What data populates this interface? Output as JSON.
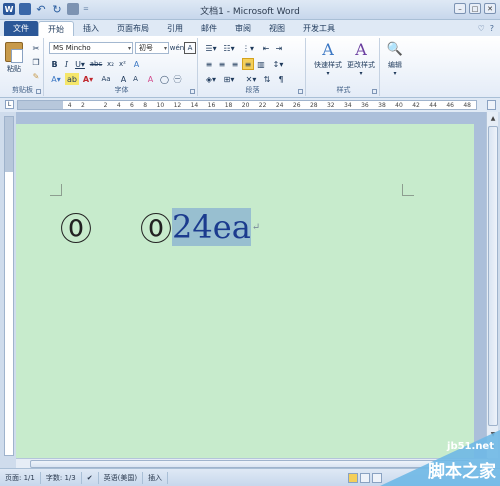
{
  "window": {
    "title": "文档1 - Microsoft Word",
    "buttons": [
      "–",
      "□",
      "✕"
    ]
  },
  "qat": {
    "word_icon": "W",
    "save_icon": "save-icon",
    "undo_icon": "↶",
    "redo_icon": "↻",
    "print_icon": "print-preview-icon",
    "dropdown": "="
  },
  "tabs": {
    "file": "文件",
    "items": [
      "开始",
      "插入",
      "页面布局",
      "引用",
      "邮件",
      "审阅",
      "视图",
      "开发工具"
    ],
    "right": [
      "♡",
      "?"
    ]
  },
  "ribbon": {
    "clipboard": {
      "paste": "粘贴",
      "label": "剪贴板"
    },
    "font": {
      "family": "MS Mincho",
      "size": "初号",
      "label": "字体",
      "grow": "A",
      "shrink": "A",
      "case": "Aa",
      "clear": "A",
      "wen": "wén",
      "char_border": "A"
    },
    "paragraph": {
      "label": "段落"
    },
    "styles": {
      "quick": "快速样式",
      "change": "更改样式",
      "label": "样式"
    },
    "editing": {
      "label": "编辑"
    }
  },
  "ruler": {
    "numbers": [
      "4",
      "2",
      "",
      "2",
      "4",
      "6",
      "8",
      "10",
      "12",
      "14",
      "16",
      "18",
      "20",
      "22",
      "24",
      "26",
      "28",
      "32",
      "34",
      "36",
      "38",
      "40",
      "42",
      "44",
      "46",
      "48"
    ]
  },
  "document": {
    "symbol1": "⓪",
    "symbol2": "⓪",
    "selected": "24ea",
    "para_mark": "↵"
  },
  "status": {
    "page": "页面: 1/1",
    "words": "字数: 1/3",
    "language": "英语(美国)",
    "mode": "插入"
  },
  "watermark": {
    "site": "jb51.net",
    "name": "脚本之家"
  },
  "colors": {
    "page_background": "#c7ebcc",
    "selection": "#98bfd0",
    "file_tab": "#2b5797"
  }
}
